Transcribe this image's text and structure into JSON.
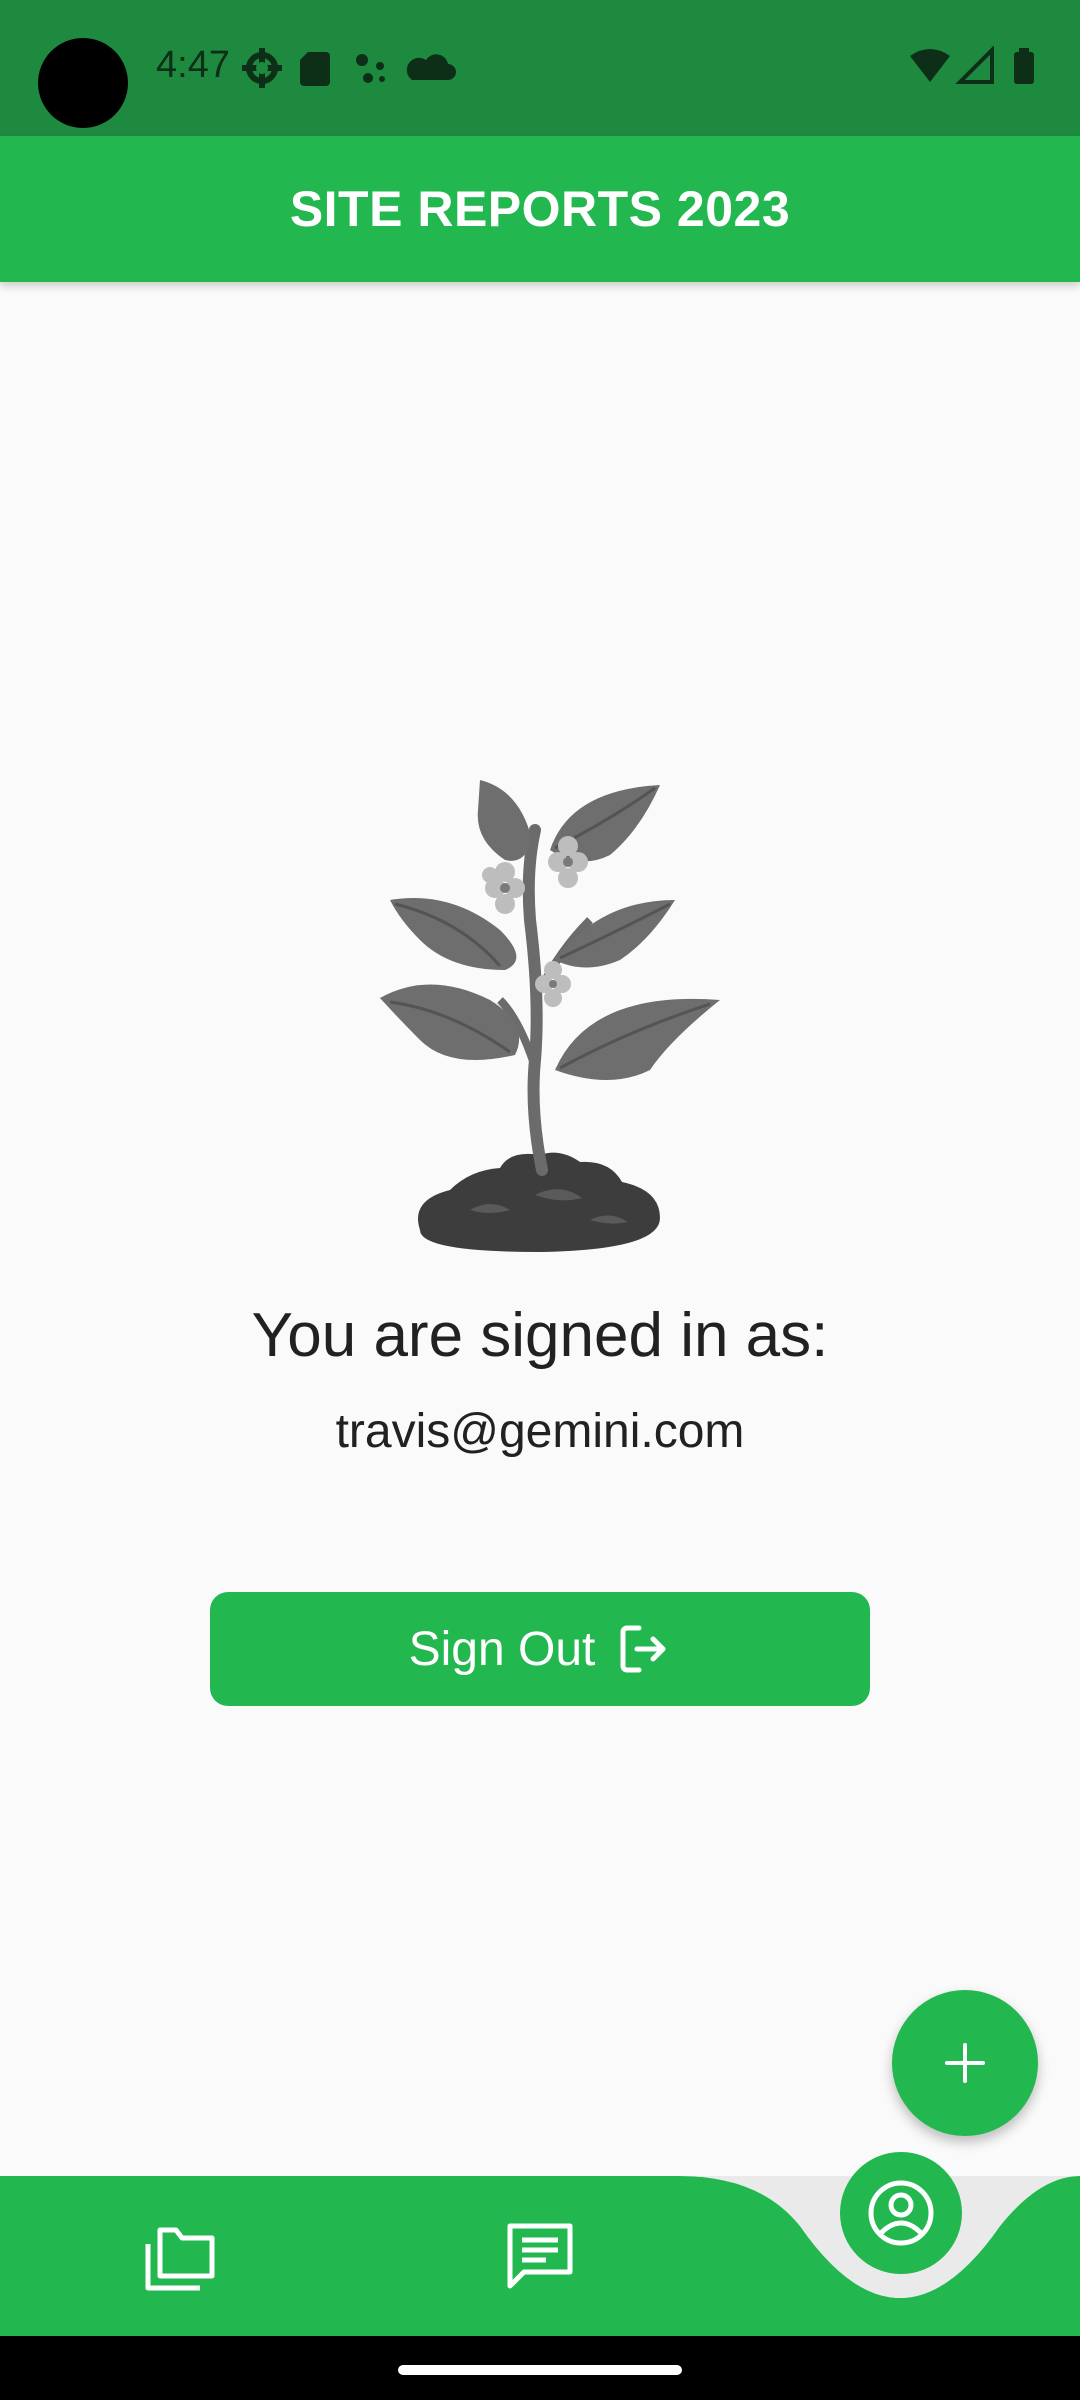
{
  "status_bar": {
    "time": "4:47",
    "left_icons": [
      "settings-gear-icon",
      "sd-card-icon",
      "assistant-dots-icon",
      "cloud-icon"
    ],
    "right_icons": [
      "wifi-icon",
      "signal-icon",
      "battery-icon"
    ]
  },
  "app_bar": {
    "title": "SITE REPORTS 2023"
  },
  "main": {
    "illustration": "plant-sprout-icon",
    "signed_in_label": "You are signed in as:",
    "email": "travis@gemini.com",
    "sign_out_label": "Sign Out"
  },
  "fab": {
    "icon": "plus-icon"
  },
  "bottom_nav": {
    "items": [
      {
        "icon": "folders-icon",
        "active": false
      },
      {
        "icon": "chat-icon",
        "active": false
      },
      {
        "icon": "account-circle-icon",
        "active": true
      }
    ]
  },
  "colors": {
    "primary": "#22b84f",
    "status_bar": "#1e8a3f",
    "background": "#fafafa",
    "text": "#212121"
  }
}
